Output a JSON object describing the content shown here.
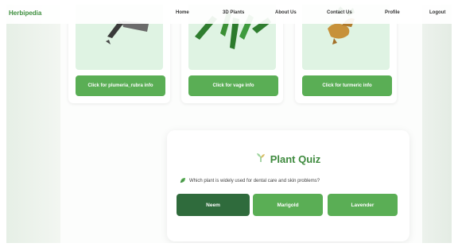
{
  "nav": {
    "brand": "Herbipedia",
    "links": [
      "Home",
      "3D Plants",
      "About Us",
      "Contact Us",
      "Profile",
      "Logout"
    ]
  },
  "cards": [
    {
      "button_label": "Click for plumeria_rubra info",
      "icon": "plumeria-plant-image"
    },
    {
      "button_label": "Click for vage info",
      "icon": "vage-plant-image"
    },
    {
      "button_label": "Click for turmeric info",
      "icon": "turmeric-plant-image"
    }
  ],
  "quiz": {
    "title": "Plant Quiz",
    "question": "Which plant is widely used for dental care and skin problems?",
    "options": [
      "Neem",
      "Marigold",
      "Lavender"
    ],
    "selected_index": 0
  },
  "colors": {
    "brand": "#3f8f3f",
    "button": "#5aae55",
    "selected": "#2f6b3c",
    "card_image_bg": "#dff3e3"
  }
}
